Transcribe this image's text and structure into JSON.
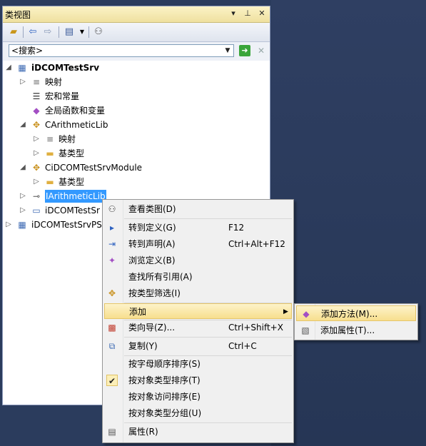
{
  "panel": {
    "title": "类视图",
    "title_buttons": {
      "dropdown": "▾",
      "pin": "⊥",
      "close": "✕"
    }
  },
  "search": {
    "value": "<搜索>"
  },
  "tree": {
    "n0": "iDCOMTestSrv",
    "n1": "映射",
    "n2": "宏和常量",
    "n3": "全局函数和变量",
    "n4": "CArithmeticLib",
    "n5": "映射",
    "n6": "基类型",
    "n7": "CiDCOMTestSrvModule",
    "n8": "基类型",
    "n9": "IArithmeticLib",
    "n10": "iDCOMTestSr",
    "n11": "iDCOMTestSrvPS"
  },
  "menu": {
    "m0": "查看类图(D)",
    "m1": "转到定义(G)",
    "m1k": "F12",
    "m2": "转到声明(A)",
    "m2k": "Ctrl+Alt+F12",
    "m3": "浏览定义(B)",
    "m4": "查找所有引用(A)",
    "m5": "按类型筛选(I)",
    "m6": "添加",
    "m7": "类向导(Z)...",
    "m7k": "Ctrl+Shift+X",
    "m8": "复制(Y)",
    "m8k": "Ctrl+C",
    "m9": "按字母顺序排序(S)",
    "m10": "按对象类型排序(T)",
    "m11": "按对象访问排序(E)",
    "m12": "按对象类型分组(U)",
    "m13": "属性(R)"
  },
  "submenu": {
    "s0": "添加方法(M)...",
    "s1": "添加属性(T)..."
  },
  "colors": {
    "highlight": "#f7df8e",
    "selection": "#3399ff",
    "titlebar": "#efe0a0"
  }
}
